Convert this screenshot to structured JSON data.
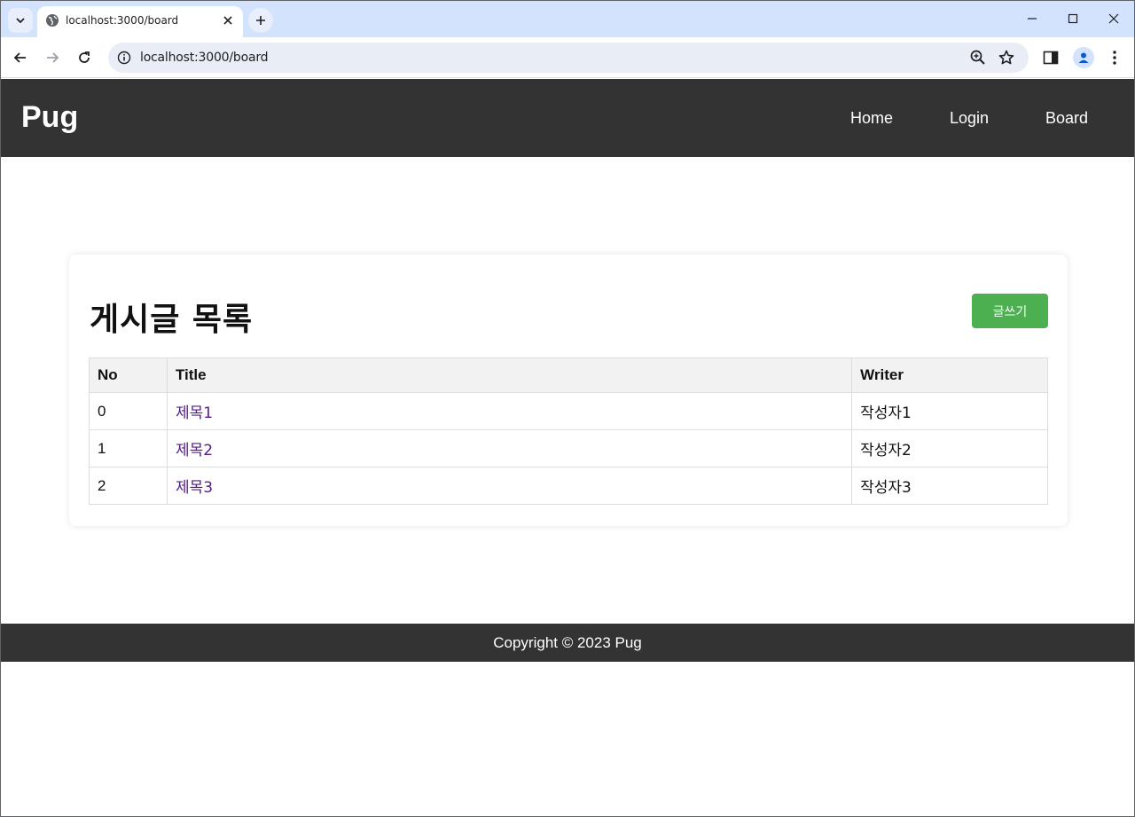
{
  "browser": {
    "tab_title": "localhost:3000/board",
    "url": "localhost:3000/board"
  },
  "site": {
    "brand": "Pug",
    "nav": [
      {
        "label": "Home"
      },
      {
        "label": "Login"
      },
      {
        "label": "Board"
      }
    ],
    "footer": "Copyright © 2023 Pug"
  },
  "board": {
    "title": "게시글 목록",
    "write_button": "글쓰기",
    "columns": {
      "no": "No",
      "title": "Title",
      "writer": "Writer"
    },
    "rows": [
      {
        "no": "0",
        "title": "제목1",
        "writer": "작성자1"
      },
      {
        "no": "1",
        "title": "제목2",
        "writer": "작성자2"
      },
      {
        "no": "2",
        "title": "제목3",
        "writer": "작성자3"
      }
    ]
  },
  "colors": {
    "header_bg": "#333333",
    "button_bg": "#4caf50",
    "link": "#551a8b",
    "tabstrip_bg": "#d3e3fd"
  }
}
